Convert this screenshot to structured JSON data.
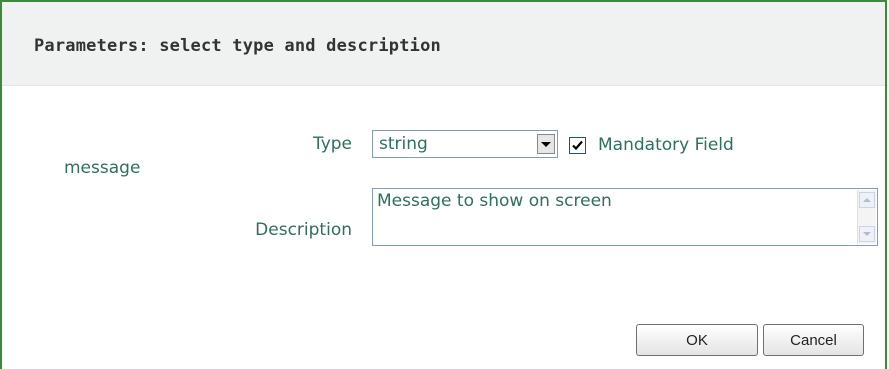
{
  "dialog": {
    "title": "Parameters: select type and description"
  },
  "parameter": {
    "name": "message",
    "type_label": "Type",
    "type_value": "string",
    "mandatory_label": "Mandatory Field",
    "mandatory_checked": true,
    "description_label": "Description",
    "description_value": "Message to show on screen"
  },
  "buttons": {
    "ok_label": "OK",
    "cancel_label": "Cancel"
  },
  "colors": {
    "border": "#3a8a3a",
    "label_text": "#2e6f60",
    "header_bg": "#f0f2f2"
  }
}
